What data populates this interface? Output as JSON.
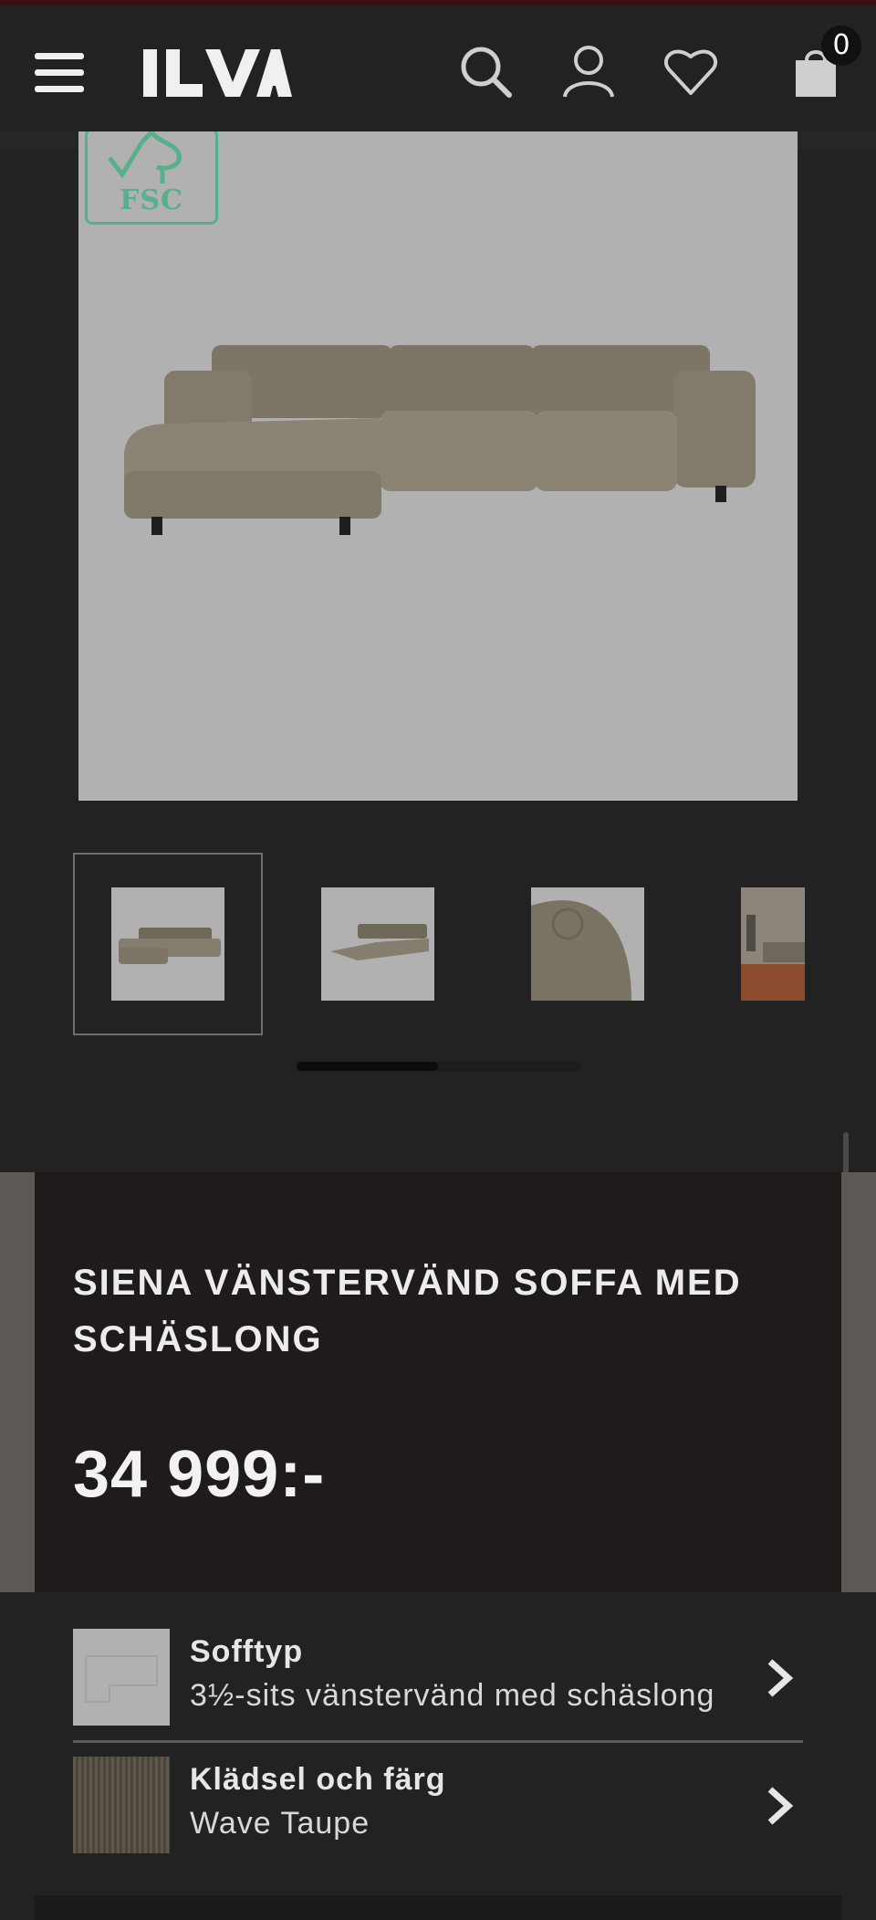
{
  "header": {
    "menu_icon": "hamburger-menu-icon",
    "logo_text": "ILVA",
    "search_icon": "search-icon",
    "account_icon": "user-icon",
    "wishlist_icon": "heart-icon",
    "cart_icon": "shopping-bag-icon",
    "cart_count": "0"
  },
  "gallery": {
    "badge_text": "FSC",
    "thumbnail_count": 4,
    "selected_thumbnail": 1,
    "carousel_progress": 0.5
  },
  "product": {
    "brand": "SIENA",
    "name": "VÄNSTERVÄND SOFFA MED SCHÄSLONG",
    "price": "34 999:-"
  },
  "options": [
    {
      "label": "Sofftyp",
      "value": "3½-sits vänstervänd med schäslong"
    },
    {
      "label": "Klädsel och färg",
      "value": "Wave Taupe"
    }
  ],
  "colors": {
    "background": "#222222",
    "panel": "#1f1b1a",
    "fsc_green": "#57b08c",
    "sofa": "#8a8272"
  }
}
